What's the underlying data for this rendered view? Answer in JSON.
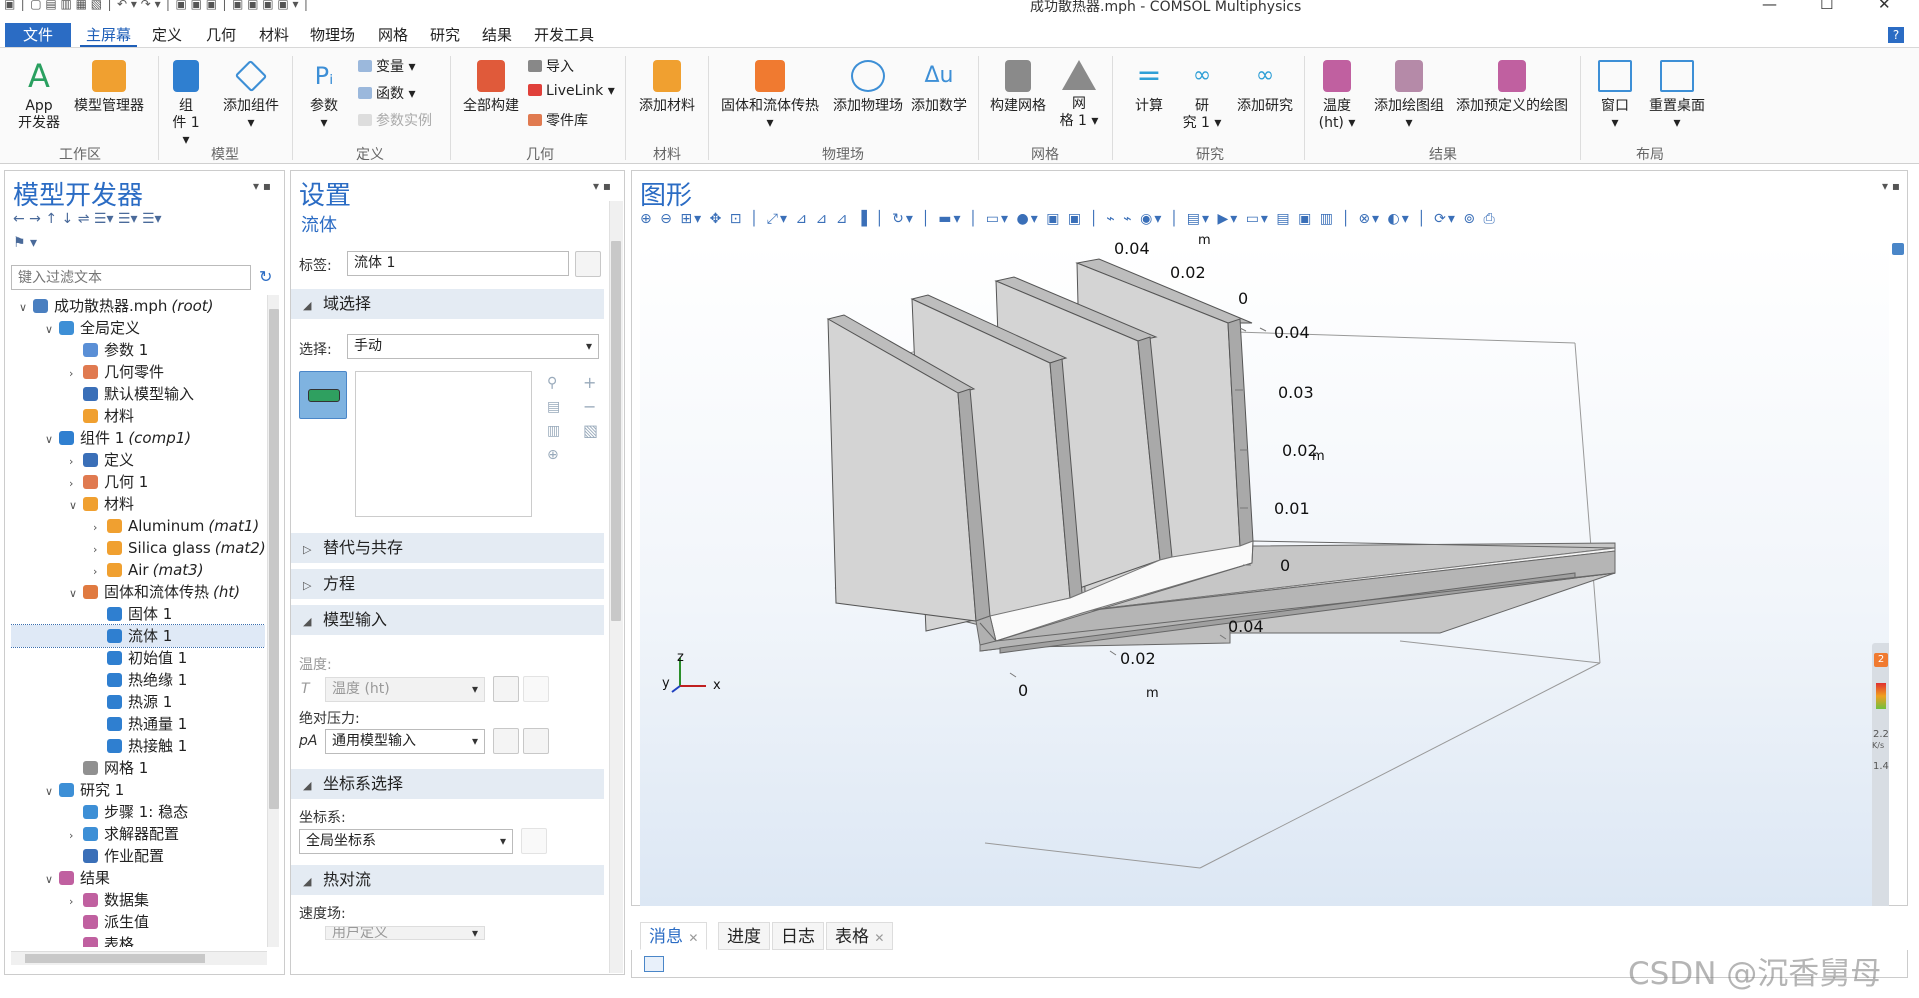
{
  "window": {
    "title": "成功散热器.mph - COMSOL Multiphysics",
    "controls": {
      "minimize": "—",
      "maximize": "☐",
      "close": "✕"
    }
  },
  "menu": {
    "tabs": [
      "文件",
      "主屏幕",
      "定义",
      "几何",
      "材料",
      "物理场",
      "网格",
      "研究",
      "结果",
      "开发工具"
    ],
    "help": "?"
  },
  "ribbon": {
    "groups": [
      {
        "label": "工作区",
        "buttons": [
          {
            "line1": "App",
            "line2": "开发器",
            "icon": "app-builder-icon"
          },
          {
            "line1": "模型管理器",
            "line2": "",
            "icon": "model-manager-icon"
          }
        ]
      },
      {
        "label": "模型",
        "buttons": [
          {
            "line1": "组",
            "line2": "件 1 ▾",
            "icon": "component-icon"
          },
          {
            "line1": "添加组件",
            "line2": "▾",
            "icon": "add-component-icon"
          }
        ]
      },
      {
        "label": "定义",
        "buttons": [
          {
            "line1": "参数",
            "line2": "▾",
            "icon": "parameters-icon"
          }
        ],
        "small": [
          "变量 ▾",
          "函数 ▾",
          "参数实例"
        ]
      },
      {
        "label": "几何",
        "buttons": [
          {
            "line1": "全部构建",
            "line2": "",
            "icon": "build-all-icon"
          }
        ],
        "small": [
          "导入",
          "LiveLink ▾",
          "零件库"
        ]
      },
      {
        "label": "材料",
        "buttons": [
          {
            "line1": "添加材料",
            "line2": "",
            "icon": "add-material-icon"
          }
        ]
      },
      {
        "label": "物理场",
        "buttons": [
          {
            "line1": "固体和流体传热",
            "line2": "▾",
            "icon": "heat-transfer-icon"
          },
          {
            "line1": "添加物理场",
            "line2": "",
            "icon": "add-physics-icon"
          },
          {
            "line1": "添加数学",
            "line2": "",
            "icon": "add-math-icon"
          }
        ]
      },
      {
        "label": "网格",
        "buttons": [
          {
            "line1": "构建网格",
            "line2": "",
            "icon": "build-mesh-icon"
          },
          {
            "line1": "网",
            "line2": "格 1 ▾",
            "icon": "mesh-icon"
          }
        ]
      },
      {
        "label": "研究",
        "buttons": [
          {
            "line1": "计算",
            "line2": "",
            "icon": "compute-icon"
          },
          {
            "line1": "研",
            "line2": "究 1 ▾",
            "icon": "study-icon"
          },
          {
            "line1": "添加研究",
            "line2": "",
            "icon": "add-study-icon"
          }
        ]
      },
      {
        "label": "结果",
        "buttons": [
          {
            "line1": "温度",
            "line2": "(ht) ▾",
            "icon": "temperature-plot-icon"
          },
          {
            "line1": "添加绘图组",
            "line2": "▾",
            "icon": "add-plot-group-icon"
          },
          {
            "line1": "添加预定义的绘图",
            "line2": "",
            "icon": "predefined-plot-icon"
          }
        ]
      },
      {
        "label": "布局",
        "buttons": [
          {
            "line1": "窗口",
            "line2": "▾",
            "icon": "windows-icon"
          },
          {
            "line1": "重置桌面",
            "line2": "▾",
            "icon": "reset-desktop-icon"
          }
        ]
      }
    ]
  },
  "model_builder": {
    "title": "模型开发器",
    "filter_placeholder": "键入过滤文本",
    "tree": [
      {
        "label": "成功散热器.mph",
        "suffix": "(root)",
        "level": 0,
        "arrow": "∨",
        "color": "#4a7fc0"
      },
      {
        "label": "全局定义",
        "suffix": "",
        "level": 1,
        "arrow": "∨",
        "color": "#3d8fd6"
      },
      {
        "label": "参数 1",
        "suffix": "",
        "level": 2,
        "arrow": "",
        "color": "#5a8fd6"
      },
      {
        "label": "几何零件",
        "suffix": "",
        "level": 2,
        "arrow": "›",
        "color": "#e07a50"
      },
      {
        "label": "默认模型输入",
        "suffix": "",
        "level": 2,
        "arrow": "",
        "color": "#3a6fb8"
      },
      {
        "label": "材料",
        "suffix": "",
        "level": 2,
        "arrow": "",
        "color": "#f0a030"
      },
      {
        "label": "组件 1",
        "suffix": "(comp1)",
        "level": 1,
        "arrow": "∨",
        "color": "#2f7fd0"
      },
      {
        "label": "定义",
        "suffix": "",
        "level": 2,
        "arrow": "›",
        "color": "#3a6fb8"
      },
      {
        "label": "几何 1",
        "suffix": "",
        "level": 2,
        "arrow": "›",
        "color": "#e07a50"
      },
      {
        "label": "材料",
        "suffix": "",
        "level": 2,
        "arrow": "∨",
        "color": "#f0a030"
      },
      {
        "label": "Aluminum",
        "suffix": "(mat1)",
        "level": 3,
        "arrow": "›",
        "color": "#f0a030"
      },
      {
        "label": "Silica glass",
        "suffix": "(mat2)",
        "level": 3,
        "arrow": "›",
        "color": "#f0a030"
      },
      {
        "label": "Air",
        "suffix": "(mat3)",
        "level": 3,
        "arrow": "›",
        "color": "#f0a030"
      },
      {
        "label": "固体和流体传热",
        "suffix": "(ht)",
        "level": 2,
        "arrow": "∨",
        "color": "#e07a40"
      },
      {
        "label": "固体 1",
        "suffix": "",
        "level": 3,
        "arrow": "",
        "color": "#2f7fd0"
      },
      {
        "label": "流体 1",
        "suffix": "",
        "level": 3,
        "arrow": "",
        "color": "#2f7fd0",
        "selected": true
      },
      {
        "label": "初始值 1",
        "suffix": "",
        "level": 3,
        "arrow": "",
        "color": "#2f7fd0"
      },
      {
        "label": "热绝缘 1",
        "suffix": "",
        "level": 3,
        "arrow": "",
        "color": "#2f7fd0"
      },
      {
        "label": "热源 1",
        "suffix": "",
        "level": 3,
        "arrow": "",
        "color": "#2f7fd0"
      },
      {
        "label": "热通量 1",
        "suffix": "",
        "level": 3,
        "arrow": "",
        "color": "#2f7fd0"
      },
      {
        "label": "热接触 1",
        "suffix": "",
        "level": 3,
        "arrow": "",
        "color": "#2f7fd0"
      },
      {
        "label": "网格 1",
        "suffix": "",
        "level": 2,
        "arrow": "",
        "color": "#909090"
      },
      {
        "label": "研究 1",
        "suffix": "",
        "level": 1,
        "arrow": "∨",
        "color": "#3d8fd6"
      },
      {
        "label": "步骤 1: 稳态",
        "suffix": "",
        "level": 2,
        "arrow": "",
        "color": "#3d8fd6"
      },
      {
        "label": "求解器配置",
        "suffix": "",
        "level": 2,
        "arrow": "›",
        "color": "#3d8fd6"
      },
      {
        "label": "作业配置",
        "suffix": "",
        "level": 2,
        "arrow": "",
        "color": "#3a6fb8"
      },
      {
        "label": "结果",
        "suffix": "",
        "level": 1,
        "arrow": "∨",
        "color": "#c060a0"
      },
      {
        "label": "数据集",
        "suffix": "",
        "level": 2,
        "arrow": "›",
        "color": "#c060a0"
      },
      {
        "label": "派生值",
        "suffix": "",
        "level": 2,
        "arrow": "",
        "color": "#c060a0"
      },
      {
        "label": "表格",
        "suffix": "",
        "level": 2,
        "arrow": "",
        "color": "#c060a0"
      }
    ]
  },
  "settings": {
    "title": "设置",
    "subtitle": "流体",
    "label_caption": "标签:",
    "label_value": "流体 1",
    "sections": {
      "domain_selection": "域选择",
      "override": "替代与共存",
      "equation": "方程",
      "model_inputs": "模型输入",
      "coord_system": "坐标系选择",
      "heat_convection": "热对流"
    },
    "selection_caption": "选择:",
    "selection_value": "手动",
    "temperature_caption": "温度:",
    "temperature_symbol": "T",
    "temperature_value": "温度 (ht)",
    "pressure_caption": "绝对压力:",
    "pressure_symbol": "pA",
    "pressure_value": "通用模型输入",
    "coord_caption": "坐标系:",
    "coord_value": "全局坐标系",
    "velocity_caption": "速度场:",
    "velocity_value": "用户定义"
  },
  "graphics": {
    "title": "图形",
    "axis_labels": {
      "top_y": [
        "0.04",
        "0.02",
        "0"
      ],
      "top_unit": "m",
      "z_ticks": [
        "0.04",
        "0.03",
        "0.02",
        "0.01",
        "0"
      ],
      "z_unit": "m",
      "x_ticks": [
        "0.04",
        "0.02",
        "0"
      ],
      "x_unit": "m"
    },
    "triad": {
      "z": "z",
      "y": "y",
      "x": "x"
    },
    "legend_top": "2",
    "legend_value": "2.2",
    "legend_unit": "K/s",
    "legend_bottom": "1.4"
  },
  "bottom_tabs": [
    "消息",
    "进度",
    "日志",
    "表格"
  ],
  "watermark": "CSDN @沉香舅母",
  "colors": {
    "accent": "#2b6cc4",
    "file_tab": "#2b6cc4",
    "heatsink_face": "#d4d4d4",
    "heatsink_dark": "#a9a9a9"
  }
}
